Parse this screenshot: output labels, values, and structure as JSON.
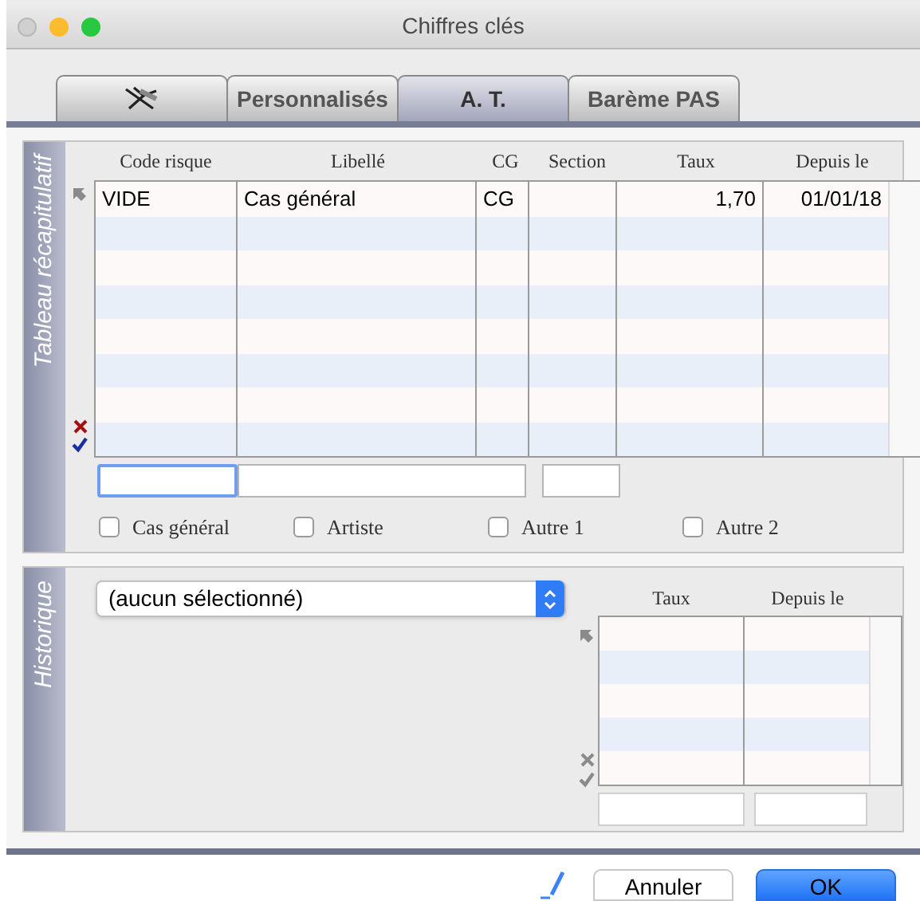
{
  "window": {
    "title": "Chiffres clés"
  },
  "tabs": [
    {
      "kind": "icon",
      "selected": false
    },
    {
      "kind": "text",
      "label": "Personnalisés",
      "selected": false
    },
    {
      "kind": "text",
      "label": "A. T.",
      "selected": true
    },
    {
      "kind": "text",
      "label": "Barème PAS",
      "selected": false
    }
  ],
  "summary": {
    "label": "Tableau récapitulatif",
    "columns": [
      "Code risque",
      "Libellé",
      "CG",
      "Section",
      "Taux",
      "Depuis le"
    ],
    "rows": [
      {
        "cells": [
          "VIDE",
          "Cas général",
          "CG",
          "",
          "1,70",
          "01/01/18"
        ]
      }
    ],
    "checkboxes": [
      {
        "label": "Cas général",
        "checked": false
      },
      {
        "label": "Artiste",
        "checked": false
      },
      {
        "label": "Autre 1",
        "checked": false
      },
      {
        "label": "Autre 2",
        "checked": false
      }
    ]
  },
  "history": {
    "label": "Historique",
    "dropdown": {
      "value": "(aucun sélectionné)"
    },
    "columns": [
      "Taux",
      "Depuis le"
    ]
  },
  "buttons": [
    {
      "label": "Annuler",
      "kind": "cancel"
    },
    {
      "label": "OK",
      "kind": "default"
    }
  ]
}
